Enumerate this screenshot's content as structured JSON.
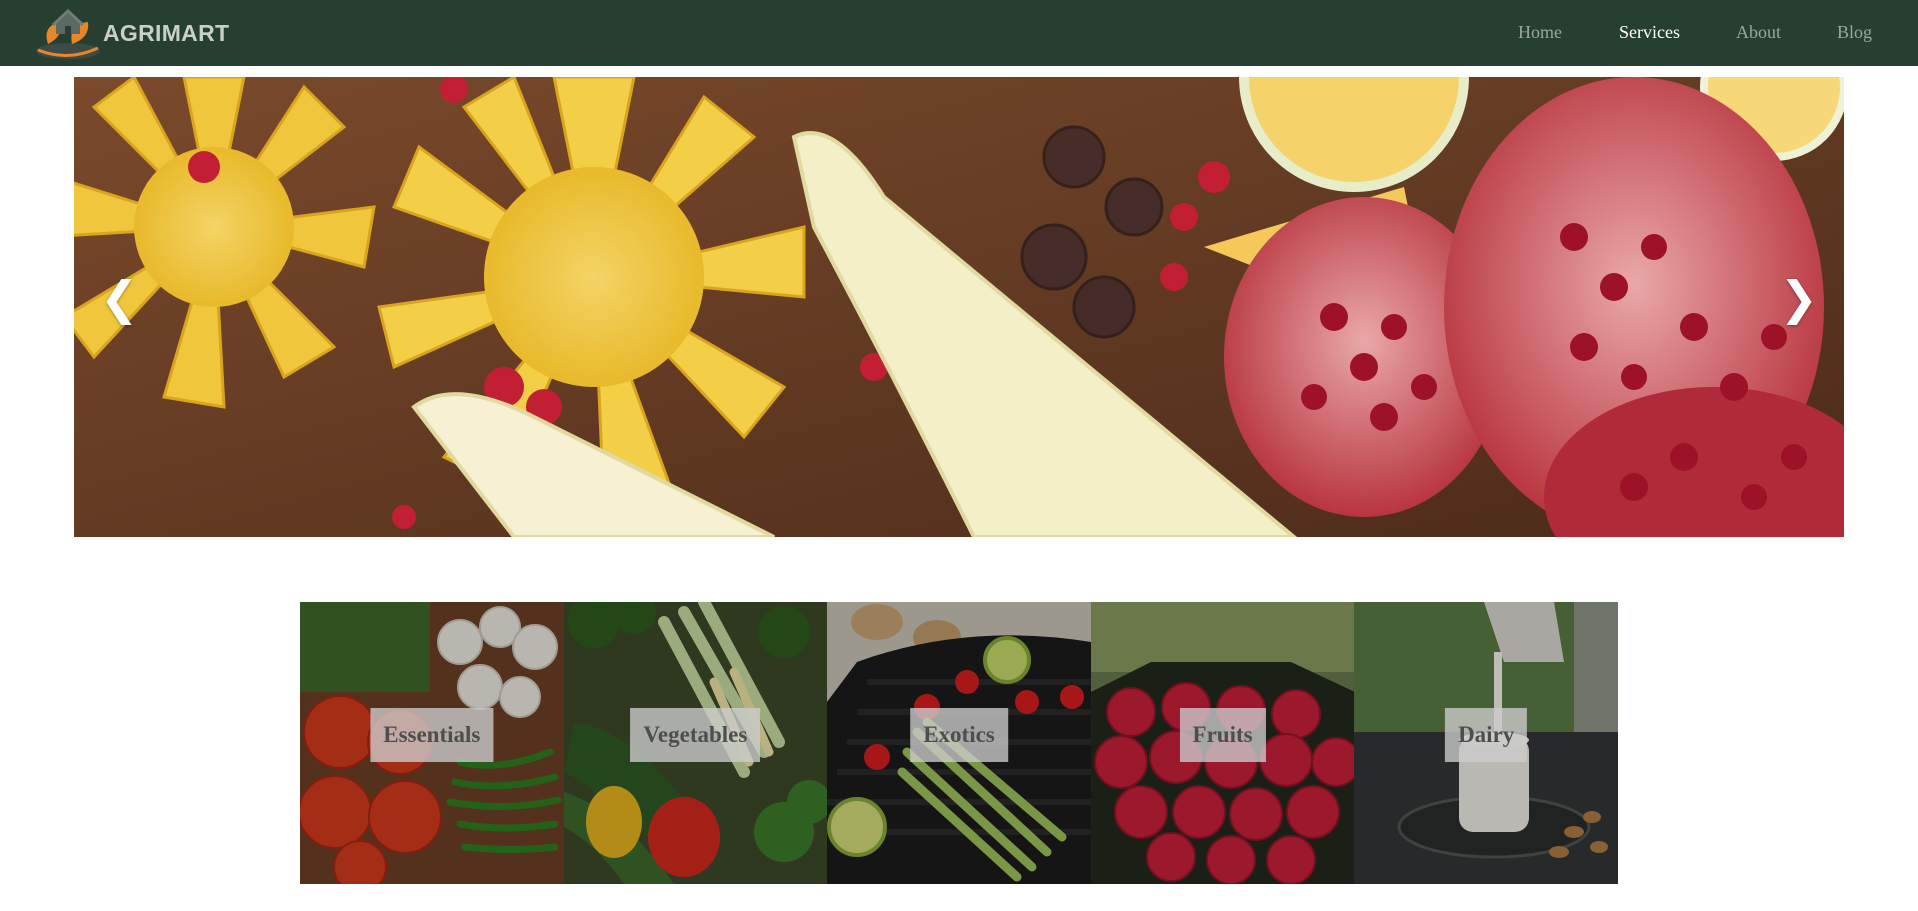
{
  "brand": {
    "name": "AGRIMART"
  },
  "nav": {
    "items": [
      {
        "label": "Home",
        "active": false
      },
      {
        "label": "Services",
        "active": true
      },
      {
        "label": "About",
        "active": false
      },
      {
        "label": "Blog",
        "active": false
      }
    ]
  },
  "carousel": {
    "prev_glyph": "❮",
    "next_glyph": "❯"
  },
  "categories": [
    {
      "label": "Essentials"
    },
    {
      "label": "Vegetables"
    },
    {
      "label": "Exotics"
    },
    {
      "label": "Fruits"
    },
    {
      "label": "Dairy"
    }
  ],
  "colors": {
    "navbar": "#263f31",
    "nav_link": "#9aa79f",
    "nav_link_active": "#ffffff",
    "logo_orange": "#e8872a"
  },
  "icons": {
    "prev": "chevron-left-icon",
    "next": "chevron-right-icon",
    "logo": "house-leaf-logo-icon"
  }
}
